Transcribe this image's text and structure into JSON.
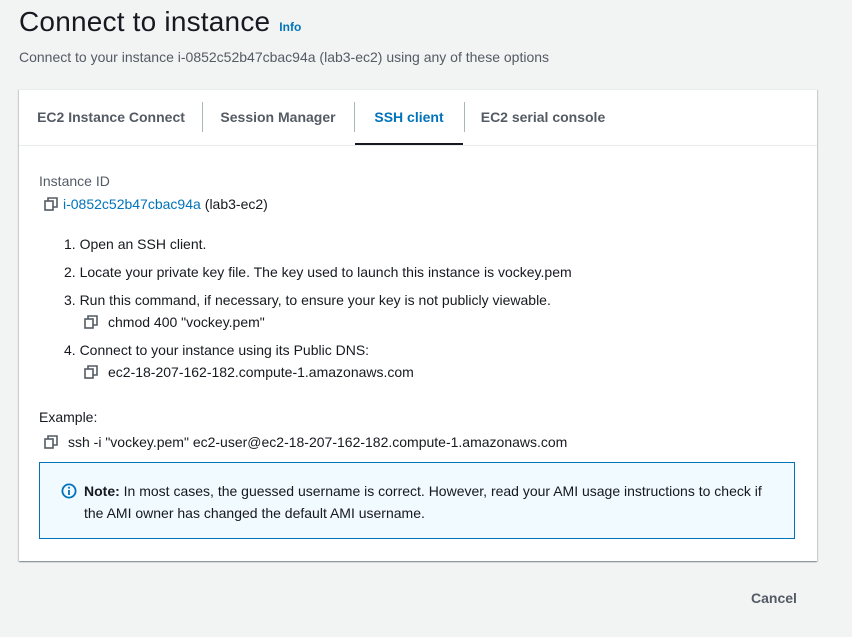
{
  "header": {
    "title": "Connect to instance",
    "info_label": "Info",
    "subtitle": "Connect to your instance i-0852c52b47cbac94a (lab3-ec2) using any of these options"
  },
  "tabs": [
    {
      "label": "EC2 Instance Connect",
      "active": false
    },
    {
      "label": "Session Manager",
      "active": false
    },
    {
      "label": "SSH client",
      "active": true
    },
    {
      "label": "EC2 serial console",
      "active": false
    }
  ],
  "ssh": {
    "instance_id_label": "Instance ID",
    "instance_id": "i-0852c52b47cbac94a",
    "instance_name": "(lab3-ec2)",
    "steps": [
      "1. Open an SSH client.",
      "2. Locate your private key file. The key used to launch this instance is vockey.pem",
      "3. Run this command, if necessary, to ensure your key is not publicly viewable.",
      "4. Connect to your instance using its Public DNS:"
    ],
    "chmod_command": "chmod 400 \"vockey.pem\"",
    "public_dns": "ec2-18-207-162-182.compute-1.amazonaws.com",
    "example_label": "Example:",
    "example_command": "ssh -i \"vockey.pem\" ec2-user@ec2-18-207-162-182.compute-1.amazonaws.com",
    "note_label": "Note:",
    "note_text": " In most cases, the guessed username is correct. However, read your AMI usage instructions to check if the AMI owner has changed the default AMI username."
  },
  "footer": {
    "cancel_label": "Cancel"
  },
  "colors": {
    "link": "#0073bb",
    "page_bg": "#f2f3f3",
    "note_bg": "#f1faff",
    "note_border": "#0073bb"
  },
  "icons": {
    "copy": "copy-icon",
    "info": "info-circle-icon"
  }
}
